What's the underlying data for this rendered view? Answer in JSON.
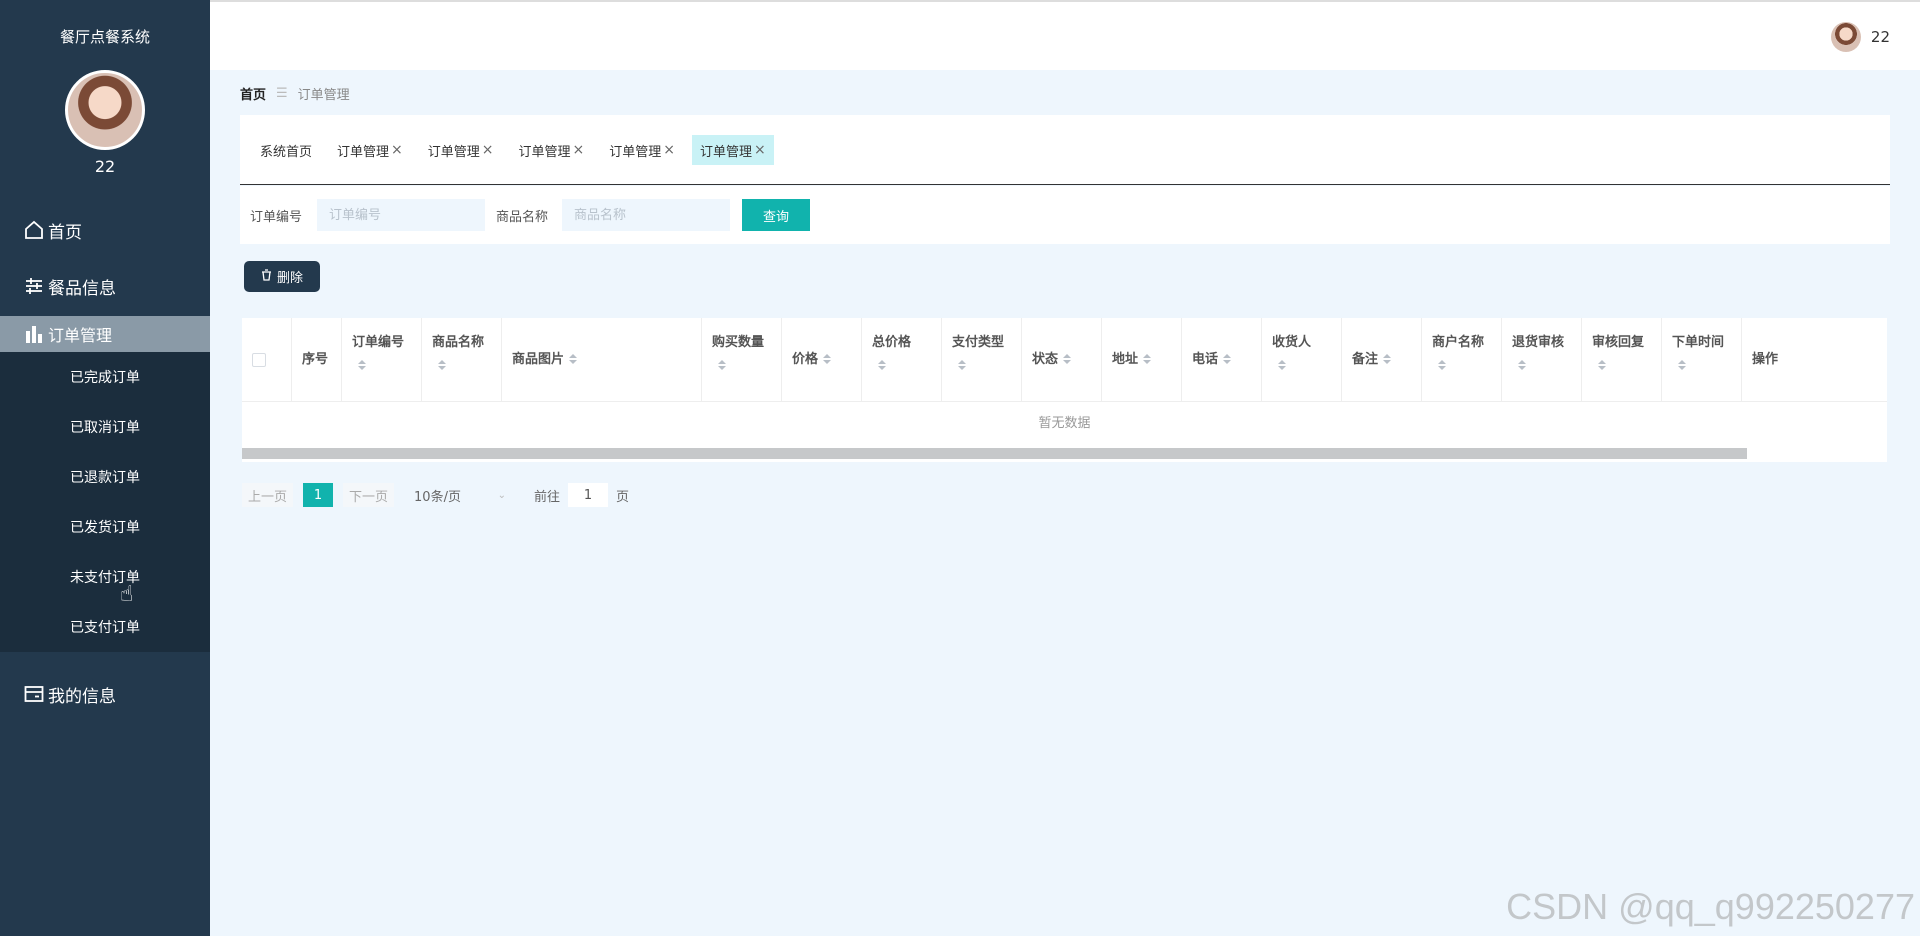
{
  "sidebar": {
    "system_title": "餐厅点餐系统",
    "user_name": "22",
    "menu": {
      "home": "首页",
      "dishes": "餐品信息",
      "orders": "订单管理",
      "my_info": "我的信息"
    },
    "submenu": [
      "已完成订单",
      "已取消订单",
      "已退款订单",
      "已发货订单",
      "未支付订单",
      "已支付订单"
    ]
  },
  "topbar": {
    "user_name": "22"
  },
  "breadcrumb": {
    "home": "首页",
    "separator": "☰",
    "current": "订单管理"
  },
  "tabs": [
    "系统首页",
    "订单管理",
    "订单管理",
    "订单管理",
    "订单管理",
    "订单管理"
  ],
  "search": {
    "order_no_label": "订单编号",
    "order_no_placeholder": "订单编号",
    "product_label": "商品名称",
    "product_placeholder": "商品名称",
    "query_label": "查询"
  },
  "actions": {
    "delete_label": "删除"
  },
  "table": {
    "columns": [
      "序号",
      "订单编号",
      "商品名称",
      "商品图片",
      "购买数量",
      "价格",
      "总价格",
      "支付类型",
      "状态",
      "地址",
      "电话",
      "收货人",
      "备注",
      "商户名称",
      "退货审核",
      "审核回复",
      "下单时间",
      "操作"
    ],
    "empty_text": "暂无数据"
  },
  "pagination": {
    "prev": "上一页",
    "current_page": "1",
    "next": "下一页",
    "page_size": "10条/页",
    "goto_label": "前往",
    "goto_value": "1",
    "page_unit": "页"
  },
  "watermark": "CSDN @qq_q992250277",
  "colors": {
    "sidebar": "#23394d",
    "accent": "#11b3ad",
    "background": "#eef6fd"
  }
}
